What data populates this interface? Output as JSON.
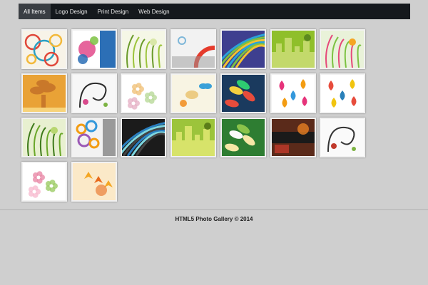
{
  "nav": {
    "items": [
      {
        "label": "All Items",
        "active": true
      },
      {
        "label": "Logo Design",
        "active": false
      },
      {
        "label": "Print Design",
        "active": false
      },
      {
        "label": "Web Design",
        "active": false
      }
    ]
  },
  "gallery": {
    "thumbnails": [
      {
        "row": 0,
        "col": 0,
        "palette": [
          "#f7f3e8",
          "#e0473a",
          "#2aa0c4",
          "#f3b93b"
        ],
        "motif": "circles"
      },
      {
        "row": 0,
        "col": 1,
        "palette": [
          "#ffffff",
          "#2c6fb6",
          "#e24a8b",
          "#7cc242"
        ],
        "motif": "swirls"
      },
      {
        "row": 0,
        "col": 2,
        "palette": [
          "#f5f7e6",
          "#9cc43b",
          "#6a9b2a",
          "#d9e7a8"
        ],
        "motif": "floral"
      },
      {
        "row": 0,
        "col": 3,
        "palette": [
          "#f2f2f2",
          "#e53b2c",
          "#9a9a9a",
          "#7fb7d9"
        ],
        "motif": "arc"
      },
      {
        "row": 0,
        "col": 4,
        "palette": [
          "#3e3f8f",
          "#2aa3d8",
          "#7bc043",
          "#f2c230"
        ],
        "motif": "stripes"
      },
      {
        "row": 0,
        "col": 5,
        "palette": [
          "#8fbf2a",
          "#1d1d1d",
          "#c3d96b",
          "#5c8a1e"
        ],
        "motif": "silhouette"
      },
      {
        "row": 0,
        "col": 6,
        "palette": [
          "#e9f2d9",
          "#7cc242",
          "#e6497a",
          "#f5a623"
        ],
        "motif": "leaves"
      },
      {
        "row": 1,
        "col": 0,
        "palette": [
          "#e9a236",
          "#5a3a1a",
          "#c9782a",
          "#f7d37a"
        ],
        "motif": "tree"
      },
      {
        "row": 1,
        "col": 1,
        "palette": [
          "#f7f7f7",
          "#2a2a2a",
          "#d94a8c",
          "#7cb342"
        ],
        "motif": "ornament"
      },
      {
        "row": 1,
        "col": 2,
        "palette": [
          "#ffffff",
          "#f0c27b",
          "#b9d99a",
          "#e6b3c7"
        ],
        "motif": "flower"
      },
      {
        "row": 1,
        "col": 3,
        "palette": [
          "#f8f4e3",
          "#e8c06a",
          "#3aa0d8",
          "#f29b3a"
        ],
        "motif": "butterfly"
      },
      {
        "row": 1,
        "col": 4,
        "palette": [
          "#1a3a5e",
          "#f4d03f",
          "#e74c3c",
          "#2ecc71"
        ],
        "motif": "tropical"
      },
      {
        "row": 1,
        "col": 5,
        "palette": [
          "#ffffff",
          "#e6337a",
          "#3498db",
          "#f39c12"
        ],
        "motif": "paisley"
      },
      {
        "row": 1,
        "col": 6,
        "palette": [
          "#ffffff",
          "#e74c3c",
          "#2980b9",
          "#f1c40f"
        ],
        "motif": "drops"
      },
      {
        "row": 2,
        "col": 0,
        "palette": [
          "#e8f0d0",
          "#6aa72a",
          "#3d7a1a",
          "#b8d670"
        ],
        "motif": "grass"
      },
      {
        "row": 2,
        "col": 1,
        "palette": [
          "#f2f2f2",
          "#f39c12",
          "#3498db",
          "#9b59b6"
        ],
        "motif": "rings"
      },
      {
        "row": 2,
        "col": 2,
        "palette": [
          "#1b1b1b",
          "#2a7fc0",
          "#7ed6df",
          "#444444"
        ],
        "motif": "waves"
      },
      {
        "row": 2,
        "col": 3,
        "palette": [
          "#9cc43b",
          "#1a1a1a",
          "#d7e36a",
          "#5b7d19"
        ],
        "motif": "city"
      },
      {
        "row": 2,
        "col": 4,
        "palette": [
          "#2e7d32",
          "#fafafa",
          "#f6e7a6",
          "#8bc34a"
        ],
        "motif": "plumeria"
      },
      {
        "row": 2,
        "col": 5,
        "palette": [
          "#5a2a1a",
          "#e67e22",
          "#1a1a1a",
          "#c0392b"
        ],
        "motif": "grunge"
      },
      {
        "row": 2,
        "col": 6,
        "palette": [
          "#fafafa",
          "#333333",
          "#c0392b",
          "#7cb342"
        ],
        "motif": "curl"
      },
      {
        "row": 3,
        "col": 0,
        "palette": [
          "#ffffff",
          "#e88aa8",
          "#9ccc65",
          "#f8bbd0"
        ],
        "motif": "roses"
      },
      {
        "row": 3,
        "col": 1,
        "palette": [
          "#fbe9c8",
          "#f4a623",
          "#e86a1c",
          "#fff3d6"
        ],
        "motif": "maple"
      }
    ]
  },
  "footer": {
    "text": "HTML5 Photo Gallery © 2014"
  }
}
